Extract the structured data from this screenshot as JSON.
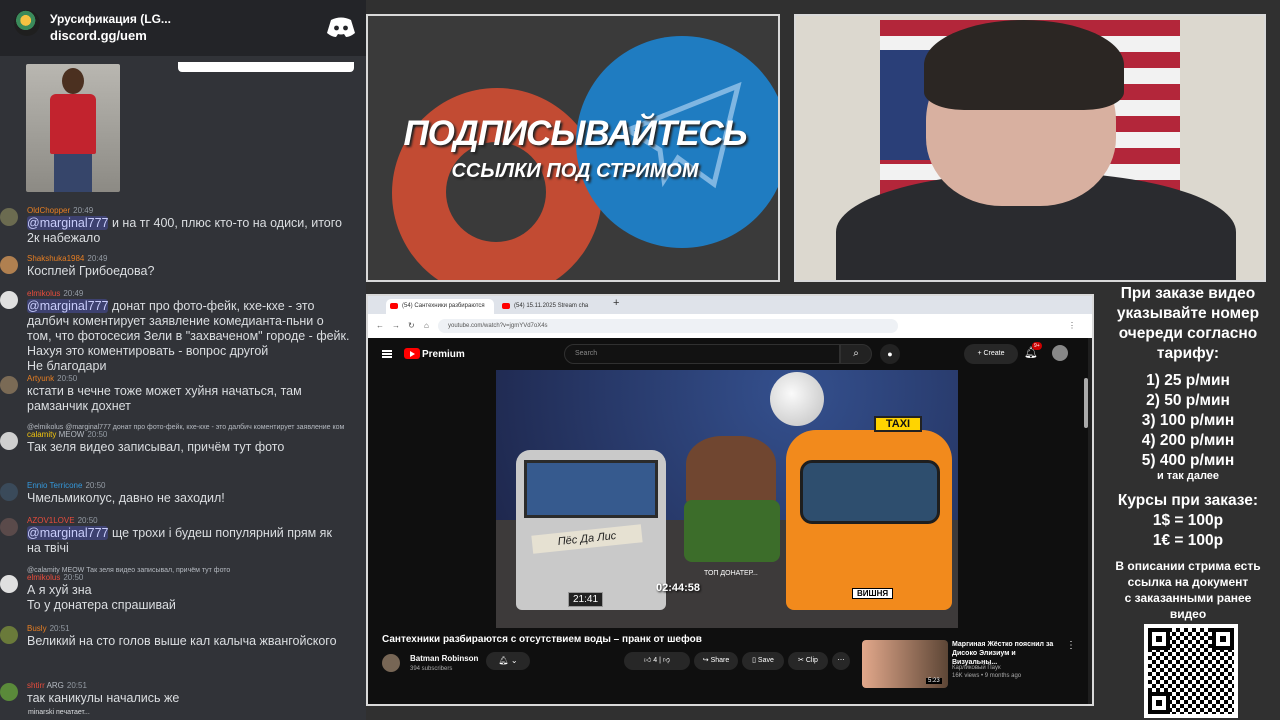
{
  "chat": {
    "server_name": "Урусификация (LG...",
    "invite": "discord.gg/uem",
    "messages": [
      {
        "user": "OldChopper",
        "user_color": "#e67e22",
        "time": "20:49",
        "mention": "@marginal777",
        "text": " и на тг 400, плюс кто-то на одиси, итого",
        "text2": "2к набежало"
      },
      {
        "user": "Shakshuka1984",
        "user_color": "#e67e22",
        "time": "20:49",
        "text": "Косплей Грибоедова?"
      },
      {
        "user": "elmikolus",
        "user_color": "#e74c3c",
        "time": "20:49",
        "mention": "@marginal777",
        "text": " донат про фото-фейк, кхе-кхе - это",
        "text2": "далбич коментирует заявление комедианта-пьни о",
        "text3": "том, что фотосесия Зели в \"захваченом\" городе - фейк.",
        "text4": "Нахуя это коментировать - вопрос другой",
        "text5": "Не благодари"
      },
      {
        "user": "Artyunk",
        "user_color": "#e67e22",
        "time": "20:50",
        "text": "кстати в чечне тоже может хуйня начаться, там",
        "text2": "рамзанчик дохнет"
      },
      {
        "reply": "@elmikolus @marginal777 донат про фото-фейк, кхе-кхе - это далбич коментирует заявление ком",
        "user": "calamity",
        "user_color": "#f1c40f",
        "badge": "MEOW",
        "time": "20:50",
        "text": "Так зеля видео записывал, причём тут фото"
      },
      {
        "user": "Ennio Terricone",
        "user_color": "#3498db",
        "time": "20:50",
        "text": "Чмельмиколус, давно не заходил!"
      },
      {
        "user": "AZOV1LOVE",
        "user_color": "#e74c3c",
        "time": "20:50",
        "mention": "@marginal777",
        "text": " ще трохи і будеш популярний прям як",
        "text2": "на твічі"
      },
      {
        "reply": "@calamity MEOW Так зеля видео записывал, причём тут фото",
        "user": "elmikolus",
        "user_color": "#e74c3c",
        "time": "20:50",
        "text": "А я хуй зна",
        "text2": "То у донатера спрашивай"
      },
      {
        "user": "Busly",
        "user_color": "#e67e22",
        "time": "20:51",
        "text": "Великий на сто голов выше кал калыча жвангойского"
      },
      {
        "user": "shtirr",
        "user_color": "#e74c3c",
        "badge": "ARG",
        "time": "20:51",
        "text": "так каникулы начались же"
      }
    ],
    "typing": "minarski печатает..."
  },
  "promo": {
    "title": "ПОДПИСЫВАЙТЕСЬ",
    "subtitle": "ССЫЛКИ ПОД СТРИМОМ"
  },
  "browser": {
    "tabs": [
      {
        "label": "(54) Сантехники разбираются"
      },
      {
        "label": "(54) 15.11.2025 Stream cha"
      }
    ],
    "url": "youtube.com/watch?v=jgmYVd7oX4s",
    "youtube": {
      "brand": "Premium",
      "search_placeholder": "Search",
      "create_label": "+ Create",
      "notif_count": "9+",
      "video": {
        "duration_overlay": "02:44:58",
        "clock": "21:41",
        "plate": "ВИШНЯ",
        "top_donator": "ТОП ДОНАТЕР...",
        "sign_text": "Пёс Да Лис",
        "taxi_sign": "TAXI"
      },
      "title": "Сантехники разбираются с отсутствием воды – пранк от шефов",
      "channel": "Batman Robinson",
      "subscribers": "394 subscribers",
      "likes": "4",
      "share_label": "Share",
      "save_label": "Save",
      "clip_label": "Clip",
      "rec_title": "Маргиная Жёстко пояснил за Дисоко Элизиум и Визуальны...",
      "rec_channel": "Карликовый Паук",
      "rec_meta": "16K views • 9 months ago",
      "rec_duration": "5:23"
    }
  },
  "info": {
    "line1": "При заказе видео",
    "line2": "указывайте номер",
    "line3": "очереди согласно",
    "line4": "тарифу:",
    "tariffs": [
      "1) 25 р/мин",
      "2) 50 р/мин",
      "3) 100 р/мин",
      "4) 200 р/мин",
      "5) 400 р/мин"
    ],
    "etc": "и так далее",
    "rates_title": "Курсы при заказе:",
    "rate1": "1$ = 100р",
    "rate2": "1€ = 100р",
    "desc1": "В описании стрима есть",
    "desc2": "ссылка на документ",
    "desc3": "с заказанными ранее",
    "desc4": "видео"
  }
}
